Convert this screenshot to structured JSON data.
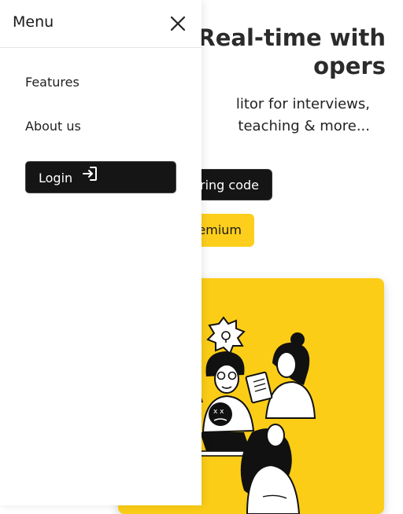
{
  "menu": {
    "title": "Menu",
    "close_icon": "close-icon",
    "items": [
      {
        "label": "Features"
      },
      {
        "label": "About us"
      }
    ],
    "login": {
      "label": "Login",
      "icon": "login-arrow-icon"
    }
  },
  "hero": {
    "title_line1": "Real-time with",
    "title_line2": "opers",
    "subtitle_line1": "litor for interviews,",
    "subtitle_line2": "teaching & more...",
    "cta_primary": "ring code",
    "cta_secondary": "emium",
    "illustration": "people-collaborating-illustration"
  },
  "colors": {
    "accent": "#fdcf1c",
    "dark_button": "#151515",
    "text": "#1a1a1a"
  }
}
